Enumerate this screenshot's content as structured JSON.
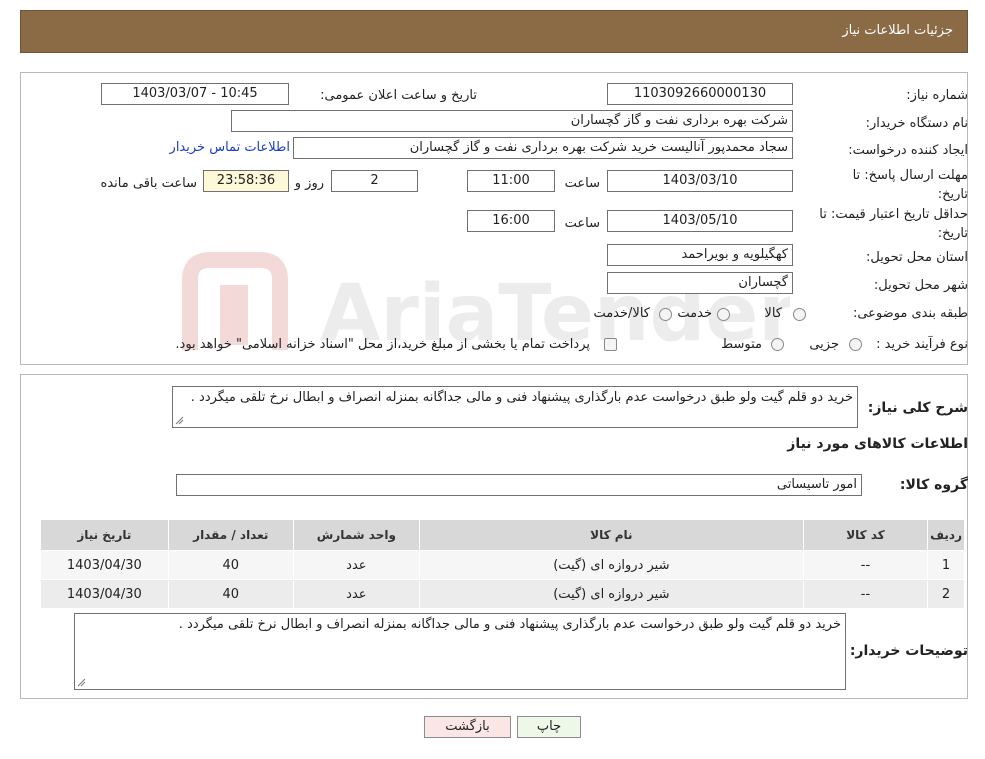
{
  "header": {
    "title": "جزئیات اطلاعات نیاز"
  },
  "labels": {
    "need_number": "شماره نیاز:",
    "announce_datetime": "تاریخ و ساعت اعلان عمومی:",
    "buyer_org": "نام دستگاه خریدار:",
    "creator": "ایجاد کننده درخواست:",
    "contact_link": "اطلاعات تماس خریدار",
    "deadline": "مهلت ارسال پاسخ: تا تاریخ:",
    "time": "ساعت",
    "day_and": "روز و",
    "remaining": "ساعت باقی مانده",
    "price_validity": "حداقل تاریخ اعتبار قیمت: تا تاریخ:",
    "province": "استان محل تحویل:",
    "city": "شهر محل تحویل:",
    "category": "طبقه بندی موضوعی:",
    "process": "نوع فرآیند خرید :",
    "general_desc": "شرح کلی نیاز:",
    "goods_info": "اطلاعات کالاهای مورد نیاز",
    "goods_group": "گروه کالا:",
    "buyer_notes": "توضیحات خریدار:"
  },
  "values": {
    "need_number": "1103092660000130",
    "announce_datetime": "1403/03/07 - 10:45",
    "buyer_org": "شرکت بهره برداری نفت و گاز گچساران",
    "creator": "سجاد محمدپور آنالیست خرید شرکت بهره برداری نفت و گاز گچساران",
    "deadline_date": "1403/03/10",
    "deadline_time": "11:00",
    "days": "2",
    "remaining_time": "23:58:36",
    "validity_date": "1403/05/10",
    "validity_time": "16:00",
    "province": "کهگیلویه و بویراحمد",
    "city": "گچساران",
    "goods_group": "امور تاسیساتی"
  },
  "category_options": [
    "کالا",
    "خدمت",
    "کالا/خدمت"
  ],
  "process_options": [
    "جزیی",
    "متوسط"
  ],
  "process_note": "پرداخت تمام یا بخشی از مبلغ خرید،از محل \"اسناد خزانه اسلامی\" خواهد بود.",
  "general_description": "خرید دو قلم گیت ولو طبق درخواست عدم بارگذاری پیشنهاد فنی و مالی جداگانه بمنزله انصراف و ابطال نرخ تلقی میگردد .",
  "table": {
    "headers": [
      "ردیف",
      "کد کالا",
      "نام کالا",
      "واحد شمارش",
      "تعداد / مقدار",
      "تاریخ نیاز"
    ],
    "rows": [
      [
        "1",
        "--",
        "شیر دروازه ای (گیت)",
        "عدد",
        "40",
        "1403/04/30"
      ],
      [
        "2",
        "--",
        "شیر دروازه ای (گیت)",
        "عدد",
        "40",
        "1403/04/30"
      ]
    ]
  },
  "buyer_notes": "خرید دو قلم گیت ولو طبق درخواست عدم بارگذاری پیشنهاد فنی و مالی جداگانه بمنزله انصراف و ابطال نرخ تلقی میگردد .",
  "buttons": {
    "print": "چاپ",
    "back": "بازگشت"
  },
  "colors": {
    "header_bg": "#8b6b45",
    "link": "#1a3fc2",
    "print_bg": "#eef8e8",
    "back_bg": "#fbe6e6"
  }
}
